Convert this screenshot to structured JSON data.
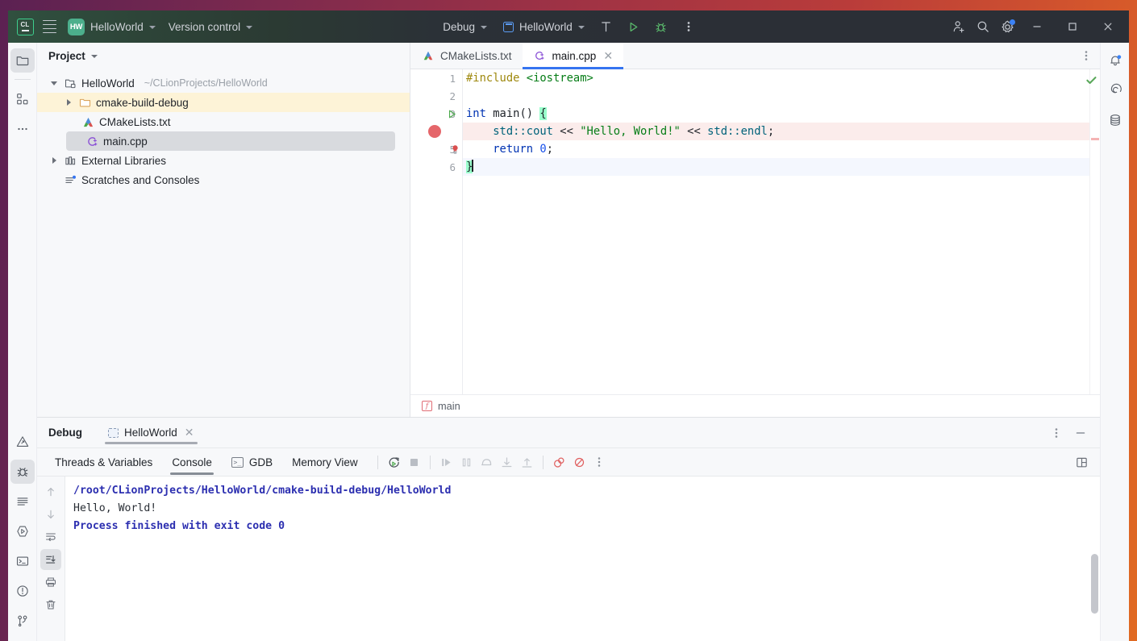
{
  "window": {
    "titlebar": {
      "logo_text": "CL",
      "menu_icon": "hamburger-menu-icon",
      "project_badge": "HW",
      "project_name": "HelloWorld",
      "version_control": "Version control",
      "run_config_mode": "Debug",
      "run_config_name": "HelloWorld",
      "build_icon": "hammer-icon",
      "run_icon": "run-triangle-icon",
      "debug_icon": "debug-bug-icon",
      "more_icon": "more-vertical-icon",
      "account_icon": "add-user-icon",
      "search_icon": "search-icon",
      "settings_icon": "gear-icon",
      "minimize": "–",
      "maximize": "□",
      "close": "✕"
    }
  },
  "left_stripe": {
    "top": [
      {
        "name": "project-tool-icon",
        "selected": true
      },
      {
        "name": "structure-tool-icon",
        "selected": false
      },
      {
        "name": "more-tools-icon",
        "selected": false
      }
    ],
    "bottom": [
      {
        "name": "problems-warning-icon",
        "selected": false
      },
      {
        "name": "debug-tool-icon",
        "selected": true
      },
      {
        "name": "build-tool-icon",
        "selected": false
      },
      {
        "name": "run-tool-icon",
        "selected": false
      },
      {
        "name": "terminal-tool-icon",
        "selected": false
      },
      {
        "name": "problems-tool-icon",
        "selected": false
      },
      {
        "name": "version-control-tool-icon",
        "selected": false
      }
    ]
  },
  "right_stripe": {
    "items": [
      {
        "name": "notifications-bell-icon",
        "badge": true
      },
      {
        "name": "ai-assistant-icon",
        "badge": false
      },
      {
        "name": "database-icon",
        "badge": false
      }
    ]
  },
  "project": {
    "panel_title": "Project",
    "tree": [
      {
        "label": "HelloWorld",
        "path": "~/CLionProjects/HelloWorld",
        "icon": "project-folder-icon",
        "twisty": "down",
        "indent": 0,
        "state": "normal"
      },
      {
        "label": "cmake-build-debug",
        "path": "",
        "icon": "folder-icon",
        "twisty": "right",
        "indent": 1,
        "state": "highlight"
      },
      {
        "label": "CMakeLists.txt",
        "path": "",
        "icon": "cmake-file-icon",
        "twisty": "none",
        "indent": 1,
        "state": "normal"
      },
      {
        "label": "main.cpp",
        "path": "",
        "icon": "cpp-file-icon",
        "twisty": "none",
        "indent": 1,
        "state": "selected"
      },
      {
        "label": "External Libraries",
        "path": "",
        "icon": "library-icon",
        "twisty": "right",
        "indent": 0,
        "state": "normal"
      },
      {
        "label": "Scratches and Consoles",
        "path": "",
        "icon": "scratches-icon",
        "twisty": "none",
        "indent": 0,
        "state": "normal"
      }
    ]
  },
  "editor": {
    "tabs": [
      {
        "label": "CMakeLists.txt",
        "icon": "cmake-file-icon",
        "active": false,
        "closable": false
      },
      {
        "label": "main.cpp",
        "icon": "cpp-file-icon",
        "active": true,
        "closable": true
      }
    ],
    "tab_menu_icon": "more-vertical-icon",
    "inspection_status": "ok-checkmark-icon",
    "line_numbers": [
      "1",
      "2",
      "3",
      "4",
      "5",
      "6"
    ],
    "breakpoint_line": 4,
    "gutter_run_line": 3,
    "gutter_bulb_line": 5,
    "caret_line": 6,
    "code": {
      "l1_pp": "#include",
      "l1_hdr": "<iostream>",
      "l3_k": "int",
      "l3_fn": " main() ",
      "l3_brace": "{",
      "l4_indent": "    ",
      "l4_ns": "std::cout",
      "l4_op": " << ",
      "l4_str": "\"Hello, World!\"",
      "l4_op2": " << ",
      "l4_ns2": "std::endl",
      "l4_end": ";",
      "l5_indent": "    ",
      "l5_k": "return",
      "l5_num": " 0",
      "l5_end": ";",
      "l6_brace": "}"
    },
    "breadcrumb": {
      "icon": "function-icon",
      "label": "main"
    }
  },
  "debug": {
    "panel_title": "Debug",
    "session_tab": "HelloWorld",
    "session_icon": "session-icon",
    "session_close": "✕",
    "header_more_icon": "more-vertical-icon",
    "header_minimize_icon": "minimize-icon",
    "tabs": [
      {
        "label": "Threads & Variables",
        "icon": "",
        "active": false
      },
      {
        "label": "Console",
        "icon": "",
        "active": true
      },
      {
        "label": "GDB",
        "icon": "gdb-console-icon",
        "active": false
      },
      {
        "label": "Memory View",
        "icon": "",
        "active": false
      }
    ],
    "toolbar_icons": [
      {
        "name": "rerun-icon"
      },
      {
        "name": "stop-icon"
      },
      {
        "name": "resume-program-icon"
      },
      {
        "name": "pause-program-icon"
      },
      {
        "name": "step-over-icon"
      },
      {
        "name": "step-into-icon"
      },
      {
        "name": "step-out-icon"
      },
      {
        "name": "view-breakpoints-icon"
      },
      {
        "name": "mute-breakpoints-icon"
      },
      {
        "name": "more-vertical-icon"
      }
    ],
    "layout_icon": "layout-settings-icon",
    "console_gutter_icons": [
      {
        "name": "scroll-up-icon",
        "selected": false
      },
      {
        "name": "scroll-down-icon",
        "selected": false
      },
      {
        "name": "soft-wrap-icon",
        "selected": false
      },
      {
        "name": "scroll-to-end-icon",
        "selected": true
      },
      {
        "name": "print-icon",
        "selected": false
      },
      {
        "name": "clear-all-icon",
        "selected": false
      }
    ],
    "console_output": [
      {
        "text": "/root/CLionProjects/HelloWorld/cmake-build-debug/HelloWorld",
        "style": "link"
      },
      {
        "text": "Hello, World!",
        "style": "plain"
      },
      {
        "text": "",
        "style": "plain"
      },
      {
        "text": "Process finished with exit code 0",
        "style": "note"
      }
    ]
  },
  "colors": {
    "accent": "#3574f0",
    "breakpoint": "#e5666a",
    "breakpoint_line_bg": "#fbeceb",
    "selection_highlight": "#fdf3d7",
    "keyword": "#0033b3",
    "string": "#067d17",
    "namespace": "#00627a",
    "number": "#1750eb",
    "preprocessor": "#9e880d",
    "brace_match": "#99ffcc",
    "console_link": "#2c2fb0"
  }
}
